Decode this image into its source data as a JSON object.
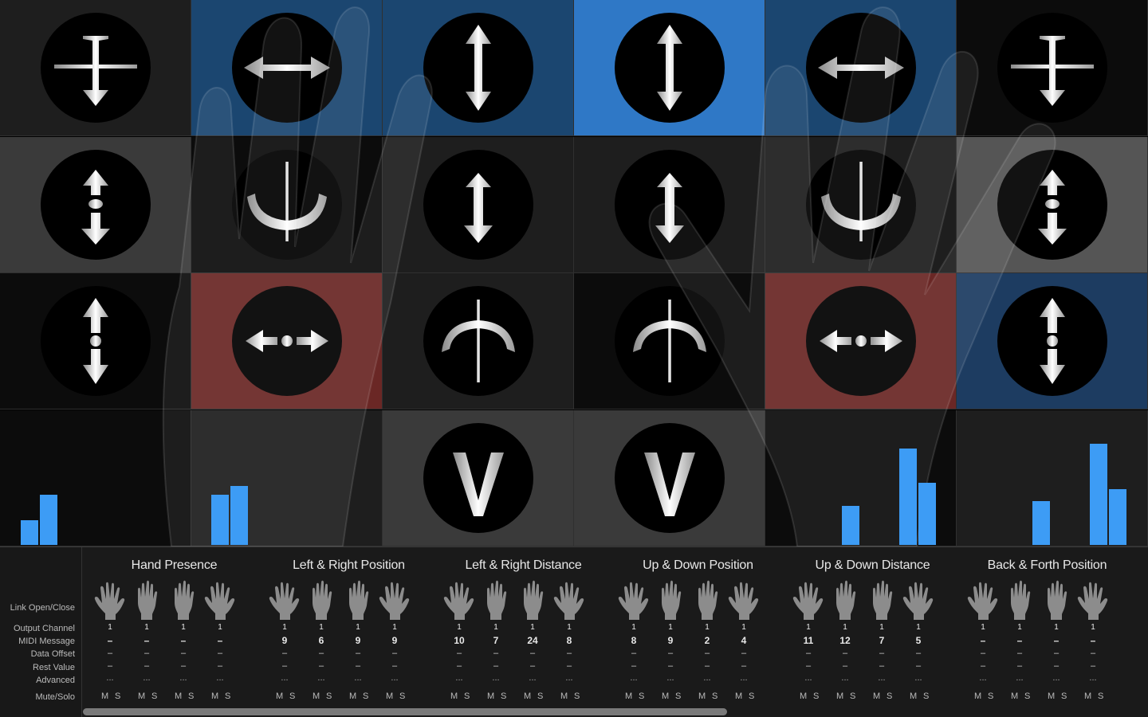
{
  "colors": {
    "blue_dark": "#1b4670",
    "blue_bright": "#2f78c6",
    "blue_deep": "#1d3c61",
    "red": "#6a2725",
    "gray_dark": "#1e1e1e",
    "gray_mid": "#3a3a3a",
    "gray_light": "#555555",
    "black": "#0c0c0c",
    "meter": "#3d9cf5"
  },
  "grid": [
    [
      {
        "icon": "up-down-plane-icon",
        "bg": "gray_dark"
      },
      {
        "icon": "left-right-arrow-icon",
        "bg": "blue_dark"
      },
      {
        "icon": "up-down-arrow-icon",
        "bg": "blue_dark"
      },
      {
        "icon": "up-down-arrow-icon",
        "bg": "blue_bright"
      },
      {
        "icon": "left-right-arrow-icon",
        "bg": "blue_dark"
      },
      {
        "icon": "up-down-plane-icon",
        "bg": "black"
      }
    ],
    [
      {
        "icon": "push-pull-icon",
        "bg": "gray_mid"
      },
      {
        "icon": "tilt-curve-icon",
        "bg": "black"
      },
      {
        "icon": "short-up-down-icon",
        "bg": "gray_dark"
      },
      {
        "icon": "short-up-down-icon",
        "bg": "gray_dark"
      },
      {
        "icon": "tilt-curve-icon",
        "bg": "gray_dark"
      },
      {
        "icon": "push-pull-icon",
        "bg": "gray_light"
      }
    ],
    [
      {
        "icon": "up-down-distance-icon",
        "bg": "black"
      },
      {
        "icon": "left-right-distance-icon",
        "bg": "red"
      },
      {
        "icon": "roll-curve-icon",
        "bg": "gray_dark"
      },
      {
        "icon": "roll-curve-icon",
        "bg": "black"
      },
      {
        "icon": "left-right-distance-icon",
        "bg": "red"
      },
      {
        "icon": "up-down-distance-icon",
        "bg": "blue_deep"
      }
    ],
    [
      {
        "icon": "",
        "bg": "black"
      },
      {
        "icon": "",
        "bg": "gray_dark"
      },
      {
        "icon": "check-icon",
        "bg": "gray_mid"
      },
      {
        "icon": "check-icon",
        "bg": "gray_mid"
      },
      {
        "icon": "",
        "bg": "black"
      },
      {
        "icon": "",
        "bg": "gray_dark"
      }
    ]
  ],
  "meters": [
    0.23,
    0.47,
    0.47,
    0.55,
    0.36,
    0.9,
    0.58,
    0.41,
    0.94,
    0.52
  ],
  "row_labels": [
    "Link Open/Close",
    "Output Channel",
    "MIDI Message",
    "Data Offset",
    "Rest Value",
    "Advanced",
    "Mute/Solo"
  ],
  "sections": [
    {
      "title": "Hand Presence",
      "hands": [
        {
          "channel": "1",
          "midi": "–",
          "offset": "–",
          "rest": "–",
          "adv": "..."
        },
        {
          "channel": "1",
          "midi": "–",
          "offset": "–",
          "rest": "–",
          "adv": "..."
        },
        {
          "channel": "1",
          "midi": "–",
          "offset": "–",
          "rest": "–",
          "adv": "..."
        },
        {
          "channel": "1",
          "midi": "–",
          "offset": "–",
          "rest": "–",
          "adv": "..."
        }
      ]
    },
    {
      "title": "Left & Right Position",
      "hands": [
        {
          "channel": "1",
          "midi": "9",
          "offset": "–",
          "rest": "–",
          "adv": "..."
        },
        {
          "channel": "1",
          "midi": "6",
          "offset": "–",
          "rest": "–",
          "adv": "..."
        },
        {
          "channel": "1",
          "midi": "9",
          "offset": "–",
          "rest": "–",
          "adv": "..."
        },
        {
          "channel": "1",
          "midi": "9",
          "offset": "–",
          "rest": "–",
          "adv": "..."
        }
      ]
    },
    {
      "title": "Left & Right Distance",
      "hands": [
        {
          "channel": "1",
          "midi": "10",
          "offset": "–",
          "rest": "–",
          "adv": "..."
        },
        {
          "channel": "1",
          "midi": "7",
          "offset": "–",
          "rest": "–",
          "adv": "..."
        },
        {
          "channel": "1",
          "midi": "24",
          "offset": "–",
          "rest": "–",
          "adv": "..."
        },
        {
          "channel": "1",
          "midi": "8",
          "offset": "–",
          "rest": "–",
          "adv": "..."
        }
      ]
    },
    {
      "title": "Up & Down Position",
      "hands": [
        {
          "channel": "1",
          "midi": "8",
          "offset": "–",
          "rest": "–",
          "adv": "..."
        },
        {
          "channel": "1",
          "midi": "9",
          "offset": "–",
          "rest": "–",
          "adv": "..."
        },
        {
          "channel": "1",
          "midi": "2",
          "offset": "–",
          "rest": "–",
          "adv": "..."
        },
        {
          "channel": "1",
          "midi": "4",
          "offset": "–",
          "rest": "–",
          "adv": "..."
        }
      ]
    },
    {
      "title": "Up & Down Distance",
      "hands": [
        {
          "channel": "1",
          "midi": "11",
          "offset": "–",
          "rest": "–",
          "adv": "..."
        },
        {
          "channel": "1",
          "midi": "12",
          "offset": "–",
          "rest": "–",
          "adv": "..."
        },
        {
          "channel": "1",
          "midi": "7",
          "offset": "–",
          "rest": "–",
          "adv": "..."
        },
        {
          "channel": "1",
          "midi": "5",
          "offset": "–",
          "rest": "–",
          "adv": "..."
        }
      ]
    },
    {
      "title": "Back & Forth Position",
      "hands": [
        {
          "channel": "1",
          "midi": "–",
          "offset": "–",
          "rest": "–",
          "adv": "..."
        },
        {
          "channel": "1",
          "midi": "–",
          "offset": "–",
          "rest": "–",
          "adv": "..."
        },
        {
          "channel": "1",
          "midi": "–",
          "offset": "–",
          "rest": "–",
          "adv": "..."
        },
        {
          "channel": "1",
          "midi": "–",
          "offset": "–",
          "rest": "–",
          "adv": "..."
        }
      ]
    }
  ],
  "mute_label": "M",
  "solo_label": "S",
  "hand_icons": [
    "open-hand-icon",
    "closed-hand-icon",
    "closed-hand-icon",
    "open-hand-icon"
  ]
}
